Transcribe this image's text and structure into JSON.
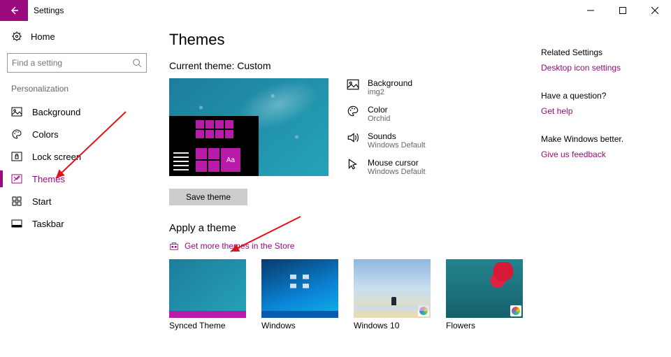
{
  "app": {
    "title": "Settings"
  },
  "sidebar": {
    "home": "Home",
    "search_placeholder": "Find a setting",
    "section": "Personalization",
    "items": [
      {
        "label": "Background"
      },
      {
        "label": "Colors"
      },
      {
        "label": "Lock screen"
      },
      {
        "label": "Themes"
      },
      {
        "label": "Start"
      },
      {
        "label": "Taskbar"
      }
    ]
  },
  "main": {
    "heading": "Themes",
    "current_label": "Current theme: Custom",
    "preview_tile_text": "Aa",
    "props": {
      "background": {
        "title": "Background",
        "value": "img2"
      },
      "color": {
        "title": "Color",
        "value": "Orchid"
      },
      "sounds": {
        "title": "Sounds",
        "value": "Windows Default"
      },
      "cursor": {
        "title": "Mouse cursor",
        "value": "Windows Default"
      }
    },
    "save_label": "Save theme",
    "apply_heading": "Apply a theme",
    "store_link": "Get more themes in the Store",
    "themes": [
      {
        "label": "Synced Theme"
      },
      {
        "label": "Windows"
      },
      {
        "label": "Windows 10"
      },
      {
        "label": "Flowers"
      }
    ]
  },
  "right": {
    "related_head": "Related Settings",
    "related_link": "Desktop icon settings",
    "question_head": "Have a question?",
    "question_link": "Get help",
    "better_head": "Make Windows better.",
    "better_link": "Give us feedback"
  }
}
